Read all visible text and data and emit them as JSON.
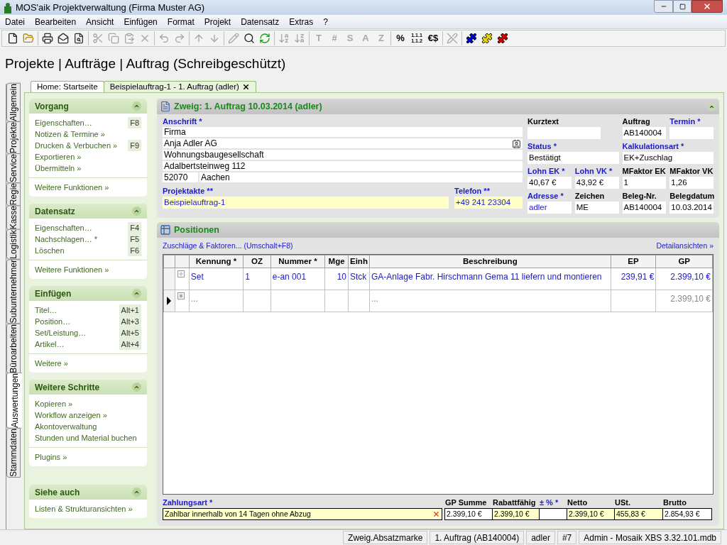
{
  "window": {
    "title": "MOS'aik Projektverwaltung (Firma Muster AG)"
  },
  "menu": [
    "Datei",
    "Bearbeiten",
    "Ansicht",
    "Einfügen",
    "Format",
    "Projekt",
    "Datensatz",
    "Extras",
    "?"
  ],
  "toolbar": [
    [
      {
        "kind": "icon",
        "disabled": false
      },
      {
        "kind": "icon",
        "disabled": false
      }
    ],
    [
      {
        "kind": "icon",
        "disabled": false
      },
      {
        "kind": "icon",
        "disabled": false
      },
      {
        "kind": "icon",
        "disabled": false
      }
    ],
    [
      {
        "kind": "icon",
        "disabled": true
      },
      {
        "kind": "icon",
        "disabled": true
      },
      {
        "kind": "icon",
        "disabled": true
      },
      {
        "kind": "icon",
        "disabled": true
      }
    ],
    [
      {
        "kind": "icon",
        "disabled": true
      },
      {
        "kind": "icon",
        "disabled": true
      }
    ],
    [
      {
        "kind": "icon",
        "disabled": true
      },
      {
        "kind": "icon",
        "disabled": true
      }
    ],
    [
      {
        "kind": "icon",
        "disabled": true
      },
      {
        "kind": "icon",
        "disabled": false
      },
      {
        "kind": "icon",
        "disabled": false
      }
    ],
    [
      {
        "kind": "icon",
        "disabled": true
      },
      {
        "kind": "icon",
        "disabled": true
      }
    ],
    [
      {
        "kind": "glyph",
        "text": "T",
        "disabled": true
      },
      {
        "kind": "glyph",
        "text": "#",
        "disabled": true
      },
      {
        "kind": "glyph",
        "text": "S",
        "disabled": true
      },
      {
        "kind": "glyph",
        "text": "A",
        "disabled": true
      },
      {
        "kind": "glyph",
        "text": "Z",
        "disabled": true
      }
    ],
    [
      {
        "kind": "glyph",
        "text": "%",
        "disabled": false
      },
      {
        "kind": "stacked",
        "lines": [
          "1.1.1",
          "1.1.2"
        ],
        "disabled": false
      },
      {
        "kind": "glyph",
        "text": "€$",
        "disabled": false
      }
    ],
    [
      {
        "kind": "icon",
        "disabled": true
      }
    ],
    [
      {
        "kind": "icon",
        "disabled": false,
        "color": "#0000cc"
      },
      {
        "kind": "icon",
        "disabled": false,
        "color": "#e8d800"
      },
      {
        "kind": "icon",
        "disabled": false,
        "color": "#d00000"
      }
    ]
  ],
  "heading": "Projekte | Aufträge | Auftrag (Schreibgeschützt)",
  "side_tabs": [
    {
      "label": "Allgemein",
      "selected": false
    },
    {
      "label": "Projekte",
      "selected": false
    },
    {
      "label": "Service",
      "selected": false
    },
    {
      "label": "Regie",
      "selected": false
    },
    {
      "label": "Kasse",
      "selected": false
    },
    {
      "label": "Logistik",
      "selected": false
    },
    {
      "label": "Subunternehmer",
      "selected": false
    },
    {
      "label": "Büroarbeiten",
      "selected": false
    },
    {
      "label": "Auswertungen",
      "selected": true
    },
    {
      "label": "Stammdaten",
      "selected": false
    }
  ],
  "doc_tabs": [
    {
      "label": "Home: Startseite",
      "selected": false,
      "closable": false
    },
    {
      "label": "Beispielauftrag-1 - 1. Auftrag (adler)",
      "selected": true,
      "closable": true
    }
  ],
  "task_sections": [
    {
      "title": "Vorgang",
      "expanded": true,
      "groups": [
        [
          {
            "label": "Eigenschaften…",
            "shortcut": "F8"
          },
          {
            "label": "Notizen & Termine »"
          },
          {
            "label": "Drucken & Verbuchen »",
            "shortcut": "F9"
          },
          {
            "label": "Exportieren »"
          },
          {
            "label": "Übermitteln »"
          }
        ],
        [
          {
            "label": "Weitere Funktionen »"
          }
        ]
      ]
    },
    {
      "title": "Datensatz",
      "expanded": true,
      "groups": [
        [
          {
            "label": "Eigenschaften…",
            "shortcut": "F4"
          },
          {
            "label": "Nachschlagen… *",
            "shortcut": "F5"
          },
          {
            "label": "Löschen",
            "shortcut": "F6"
          }
        ],
        [
          {
            "label": "Weitere Funktionen »"
          }
        ]
      ]
    },
    {
      "title": "Einfügen",
      "expanded": true,
      "groups": [
        [
          {
            "label": "Titel…",
            "shortcut": "Alt+1"
          },
          {
            "label": "Position…",
            "shortcut": "Alt+3"
          },
          {
            "label": "Set/Leistung…",
            "shortcut": "Alt+5"
          },
          {
            "label": "Artikel…",
            "shortcut": "Alt+4"
          }
        ],
        [
          {
            "label": "Weitere »"
          }
        ]
      ]
    },
    {
      "title": "Weitere Schritte",
      "expanded": true,
      "groups": [
        [
          {
            "label": "Kopieren »"
          },
          {
            "label": "Workflow anzeigen »"
          },
          {
            "label": "Akontoverwaltung"
          },
          {
            "label": "Stunden und Material buchen"
          }
        ],
        [
          {
            "label": "Plugins »"
          }
        ]
      ]
    },
    {
      "title": "Siehe auch",
      "expanded": true,
      "groups": [
        [
          {
            "label": "Listen & Strukturansichten »"
          }
        ]
      ]
    }
  ],
  "order_header": {
    "title": "Zweig: 1. Auftrag 10.03.2014 (adler)",
    "expanded": true,
    "address": {
      "label": "Anschrift *",
      "required": true,
      "lines": [
        "Firma",
        "Anja Adler AG",
        "Wohnungsbaugesellschaft",
        "Adalbertsteinweg 112"
      ],
      "zip": "52070",
      "city": "Aachen"
    },
    "bottom_fields": [
      {
        "label": "Projektakte **",
        "value": "Beispielauftrag-1",
        "required": true,
        "highlighted": true,
        "linked": true
      },
      {
        "label": "Telefon **",
        "value": "+49 241 23304",
        "required": true,
        "highlighted": true,
        "linked": true
      }
    ],
    "field_rows": [
      [
        {
          "label": "Kurztext",
          "required": false,
          "highlighted": false
        },
        {
          "label": "Auftrag",
          "value": "AB140004",
          "required": false,
          "highlighted": false,
          "linked": false
        },
        {
          "label": "Termin *",
          "required": true,
          "highlighted": false
        }
      ],
      [
        {
          "label": "Status *",
          "value": "Bestätigt",
          "required": true,
          "highlighted": false,
          "linked": false
        },
        {
          "label": "Kalkulationsart *",
          "value": "EK+Zuschlag",
          "required": true,
          "highlighted": false,
          "linked": false
        }
      ],
      [
        {
          "label": "Lohn EK *",
          "value": "40,67 €",
          "required": true,
          "highlighted": false,
          "linked": false
        },
        {
          "label": "Lohn VK *",
          "value": "43,92 €",
          "required": true,
          "highlighted": false,
          "linked": false
        },
        {
          "label": "MFaktor EK",
          "value": "1",
          "required": false,
          "highlighted": false,
          "linked": false
        },
        {
          "label": "MFaktor VK",
          "value": "1,26",
          "required": false,
          "highlighted": false,
          "linked": false
        }
      ],
      [
        {
          "label": "Adresse *",
          "value": "adler",
          "required": true,
          "highlighted": false,
          "linked": true
        },
        {
          "label": "Zeichen",
          "value": "ME",
          "required": false,
          "highlighted": false,
          "linked": false
        },
        {
          "label": "Beleg-Nr.",
          "value": "AB140004",
          "required": false,
          "highlighted": false,
          "linked": false
        },
        {
          "label": "Belegdatum",
          "value": "10.03.2014",
          "required": false,
          "highlighted": false,
          "linked": false
        }
      ]
    ]
  },
  "positions": {
    "title": "Positionen",
    "expanded": true,
    "left_link": "Zuschläge & Faktoren... (Umschalt+F8)",
    "right_link": "Detailansichten »",
    "columns": [
      {
        "label": "Kennung *",
        "kind": "text"
      },
      {
        "label": "OZ",
        "kind": "text"
      },
      {
        "label": "Nummer *",
        "kind": "text"
      },
      {
        "label": "Mge",
        "kind": "number"
      },
      {
        "label": "Einh",
        "kind": "text"
      },
      {
        "label": "Beschreibung",
        "kind": "text"
      },
      {
        "label": "EP",
        "kind": "number"
      },
      {
        "label": "GP",
        "kind": "number"
      }
    ],
    "rows": [
      {
        "kind": "item",
        "current": false,
        "cells": [
          "Set",
          "1",
          "e-an 001",
          "10",
          "Stck",
          "GA-Anlage Fabr. Hirschmann Gema 11 liefern und montieren",
          "239,91 €",
          "2.399,10 €"
        ]
      },
      {
        "kind": "new",
        "current": true,
        "cells": [
          "...",
          null,
          null,
          null,
          null,
          "...",
          null,
          "2.399,10 €"
        ]
      }
    ]
  },
  "totals": {
    "payment": {
      "label": "Zahlungsart *",
      "value": "Zahlbar innerhalb von 14 Tagen ohne Abzug",
      "required": true,
      "highlighted": true
    },
    "fields": [
      {
        "label": "GP Summe",
        "value": "2.399,10 €",
        "required": false,
        "highlighted": false
      },
      {
        "label": "Rabattfähig",
        "value": "2.399,10 €",
        "required": false,
        "highlighted": true
      },
      {
        "label": "± % *",
        "required": true,
        "highlighted": false
      },
      {
        "label": "Netto",
        "value": "2.399,10 €",
        "required": false,
        "highlighted": true
      },
      {
        "label": "USt.",
        "value": "455,83 €",
        "required": false,
        "highlighted": true
      },
      {
        "label": "Brutto",
        "value": "2.854,93 €",
        "required": false,
        "highlighted": false
      }
    ]
  },
  "status_bar": [
    "Zweig.Absatzmarke",
    "1. Auftrag (AB140004)",
    "adler",
    "#7",
    "Admin - Mosaik XBS 3.32.101.mdb"
  ]
}
